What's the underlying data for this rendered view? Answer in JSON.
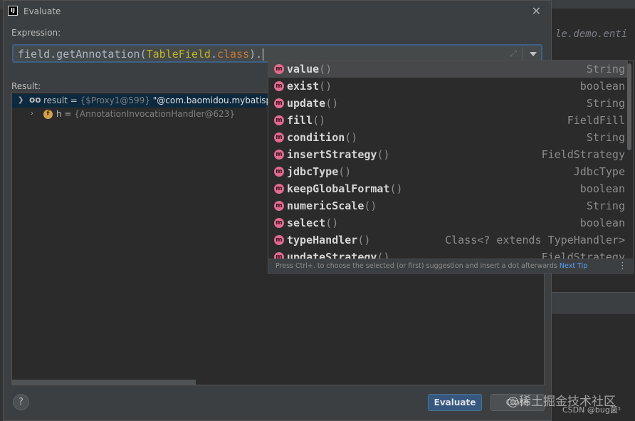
{
  "window": {
    "title": "Evaluate",
    "icon": "intellij-icon",
    "close_icon": "close-icon"
  },
  "background": {
    "code_snippet": "le.demo.enti"
  },
  "expression": {
    "label": "Expression:",
    "parts": [
      "field.getAnnotation(",
      "TableField",
      ".",
      "class",
      ")."
    ]
  },
  "result": {
    "label": "Result:",
    "rows": [
      {
        "name": "result",
        "eq": " = ",
        "type": "{$Proxy1@599} ",
        "value": "\"@com.baomidou.mybatisplus"
      },
      {
        "badge": "f",
        "name": "h",
        "eq": " = ",
        "type": "{AnnotationInvocationHandler@623}"
      }
    ]
  },
  "completion": {
    "items": [
      {
        "name": "value",
        "parens": "()",
        "type": "String",
        "selected": true
      },
      {
        "name": "exist",
        "parens": "()",
        "type": "boolean"
      },
      {
        "name": "update",
        "parens": "()",
        "type": "String"
      },
      {
        "name": "fill",
        "parens": "()",
        "type": "FieldFill"
      },
      {
        "name": "condition",
        "parens": "()",
        "type": "String"
      },
      {
        "name": "insertStrategy",
        "parens": "()",
        "type": "FieldStrategy"
      },
      {
        "name": "jdbcType",
        "parens": "()",
        "type": "JdbcType"
      },
      {
        "name": "keepGlobalFormat",
        "parens": "()",
        "type": "boolean"
      },
      {
        "name": "numericScale",
        "parens": "()",
        "type": "String"
      },
      {
        "name": "select",
        "parens": "()",
        "type": "boolean"
      },
      {
        "name": "typeHandler",
        "parens": "()",
        "type": "Class<? extends TypeHandler>"
      },
      {
        "name": "updateStrategy",
        "parens": "()",
        "type": "FieldStrategy"
      }
    ],
    "footer_hint": "Press Ctrl+. to choose the selected (or first) suggestion and insert a dot afterwards ",
    "footer_link": "Next Tip",
    "more_icon": "more-vertical-icon"
  },
  "buttons": {
    "help": "?",
    "evaluate": "Evaluate",
    "close": "Close"
  },
  "watermark": {
    "main": "@稀土掘金技术社区",
    "sub": "CSDN @bug菌¹"
  },
  "colors": {
    "accent": "#365880",
    "selection": "#0d293e",
    "method_icon": "#e06b8e",
    "field_icon": "#d5a14d"
  }
}
